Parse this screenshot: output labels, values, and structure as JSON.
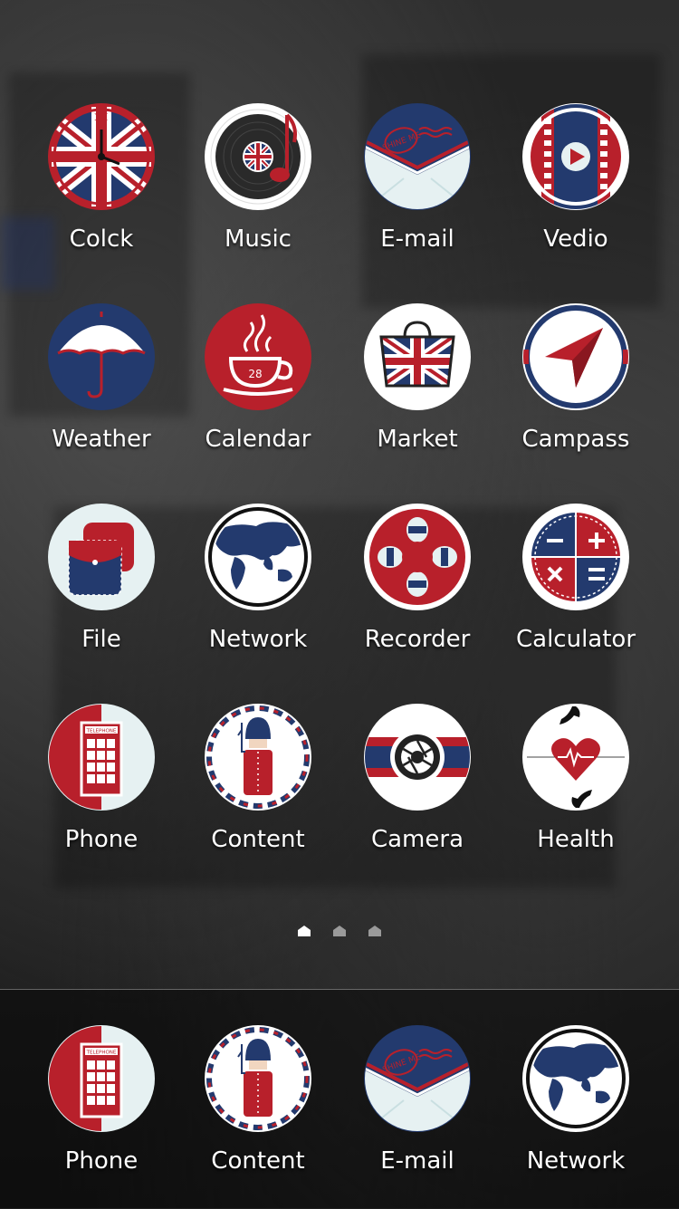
{
  "grid": [
    {
      "label": "Colck",
      "icon": "union-jack-clock-icon"
    },
    {
      "label": "Music",
      "icon": "vinyl-record-music-icon"
    },
    {
      "label": "E-mail",
      "icon": "envelope-stamp-icon"
    },
    {
      "label": "Vedio",
      "icon": "film-strip-play-icon"
    },
    {
      "label": "Weather",
      "icon": "umbrella-icon"
    },
    {
      "label": "Calendar",
      "icon": "coffee-cup-icon"
    },
    {
      "label": "Market",
      "icon": "union-jack-shopping-bag-icon"
    },
    {
      "label": "Campass",
      "icon": "compass-arrow-icon"
    },
    {
      "label": "File",
      "icon": "folder-pouch-icon"
    },
    {
      "label": "Network",
      "icon": "globe-map-icon"
    },
    {
      "label": "Recorder",
      "icon": "reel-icon"
    },
    {
      "label": "Calculator",
      "icon": "calculator-operators-icon"
    },
    {
      "label": "Phone",
      "icon": "telephone-booth-icon"
    },
    {
      "label": "Content",
      "icon": "royal-guard-icon"
    },
    {
      "label": "Camera",
      "icon": "camera-aperture-icon"
    },
    {
      "label": "Health",
      "icon": "heart-hands-icon"
    }
  ],
  "calendar_date": "28",
  "phone_booth_sign": "TELEPHONE",
  "stamp_text": "SHINE ME",
  "page_indicator": {
    "count": 3,
    "active": 0
  },
  "dock": [
    {
      "label": "Phone",
      "icon": "telephone-booth-icon"
    },
    {
      "label": "Content",
      "icon": "royal-guard-icon"
    },
    {
      "label": "E-mail",
      "icon": "envelope-stamp-icon"
    },
    {
      "label": "Network",
      "icon": "globe-map-icon"
    }
  ],
  "colors": {
    "red": "#b8202b",
    "navy": "#233a6e",
    "white": "#ffffff",
    "paper": "#e6f1f2"
  }
}
